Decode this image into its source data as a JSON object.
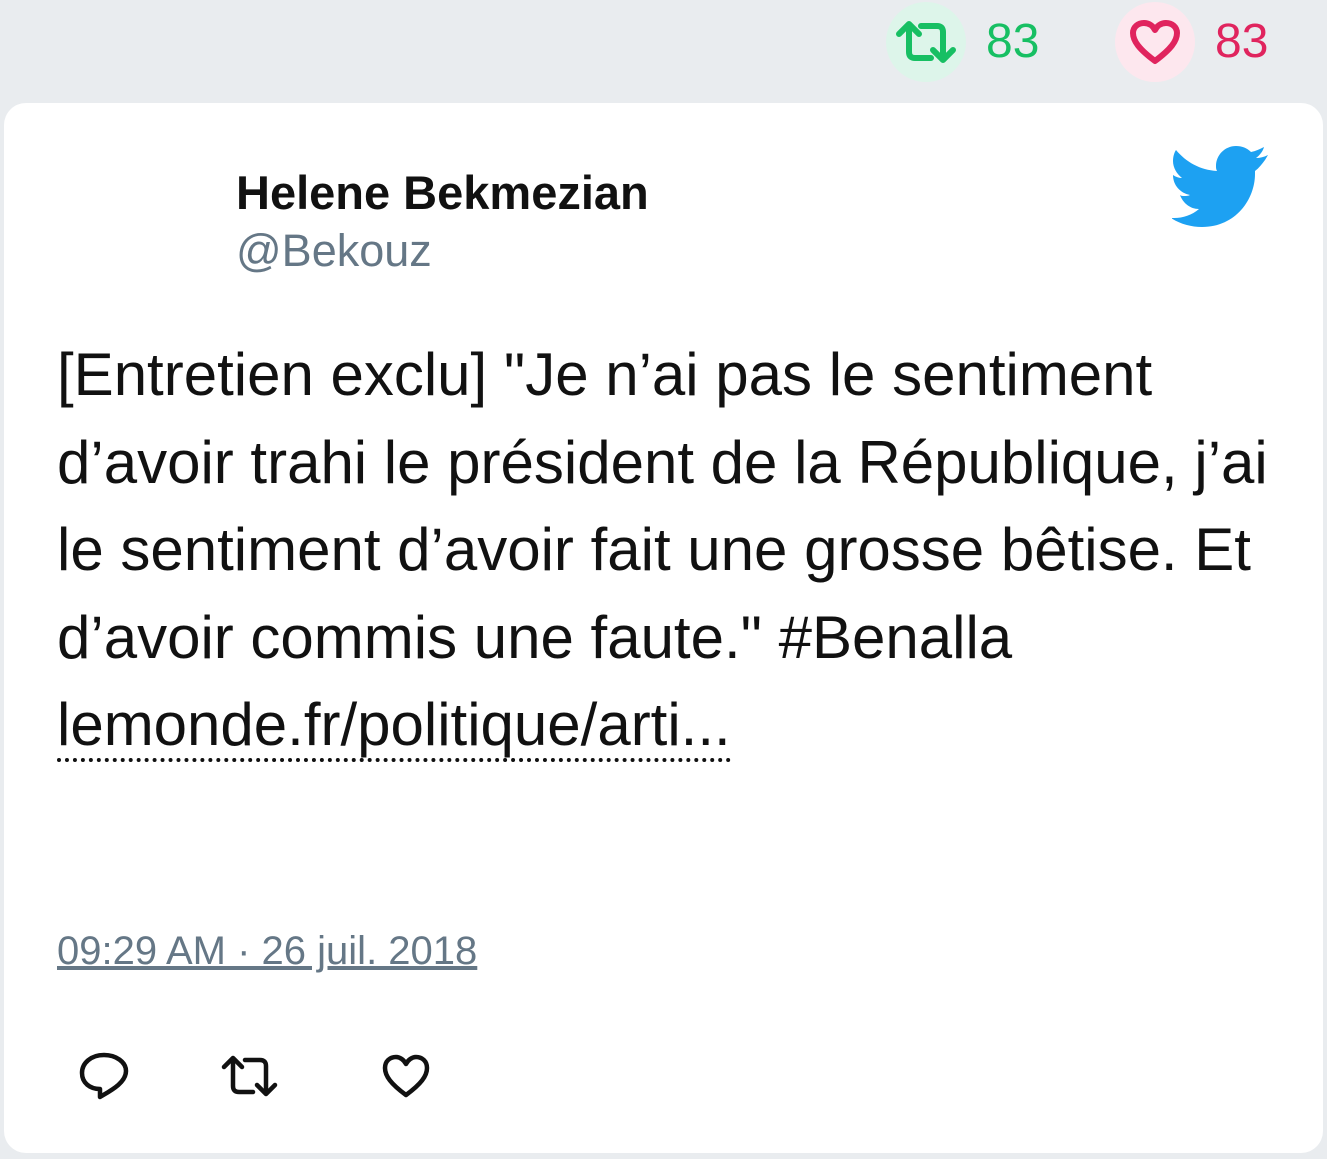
{
  "stats": {
    "retweet_count": "83",
    "like_count": "83"
  },
  "tweet": {
    "author_name": "Helene Bekmezian",
    "author_handle": "@Bekouz",
    "text": "[Entretien exclu] \"Je n’ai pas le sentiment d’avoir trahi le président de la République, j’ai le sentiment d’avoir fait une grosse bêtise. Et d’avoir commis une faute.\" #Benalla",
    "link_text": "lemonde.fr/politique/arti...",
    "timestamp": "09:29 AM · 26 juil. 2018"
  },
  "icons": {
    "top_retweet": "retweet-icon",
    "top_like": "heart-icon",
    "brand": "twitter-bird-icon",
    "reply": "reply-icon",
    "retweet": "retweet-icon",
    "like": "heart-icon"
  },
  "colors": {
    "retweet": "#17bf63",
    "like": "#e0245e",
    "twitter_blue": "#1da1f2",
    "muted": "#657786"
  }
}
